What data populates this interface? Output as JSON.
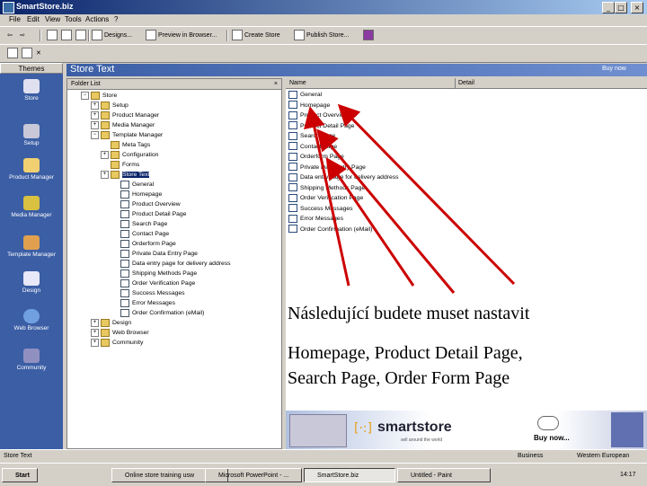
{
  "window": {
    "title": "SmartStore.biz"
  },
  "menu": [
    "File",
    "Edit",
    "View",
    "Tools",
    "Actions",
    "?"
  ],
  "toolbar": {
    "designs": "Designs...",
    "preview": "Preview in Browser...",
    "create_store": "Create Store",
    "publish_store": "Publish Store..."
  },
  "themes": {
    "header": "Themes",
    "items": [
      "Store",
      "Setup",
      "Product Manager",
      "Media Manager",
      "Template Manager",
      "Design",
      "Web Browser",
      "Community"
    ]
  },
  "main": {
    "title": "Store Text",
    "buy_now": "Buy now"
  },
  "folder_list": {
    "header": "Folder List",
    "items": [
      "Store",
      "Setup",
      "Product Manager",
      "Media Manager",
      "Template Manager",
      "Meta Tags",
      "Configuration",
      "Forms",
      "Store Text",
      "General",
      "Homepage",
      "Product Overview",
      "Product Detail Page",
      "Search Page",
      "Contact Page",
      "Orderform Page",
      "Private Data Entry Page",
      "Data entry page for delivery address",
      "Shipping Methods Page",
      "Order Verification Page",
      "Success Messages",
      "Error Messages",
      "Order Confirmation (eMail)",
      "Design",
      "Web Browser",
      "Community"
    ]
  },
  "item_list": {
    "col_name": "Name",
    "col_detail": "Detail",
    "items": [
      "General",
      "Homepage",
      "Product Overview",
      "Product Detail Page",
      "Search Page",
      "Contact Page",
      "Orderform Page",
      "Private Data Entry Page",
      "Data entry page for delivery address",
      "Shipping Methods Page",
      "Order Verification Page",
      "Success Messages",
      "Error Messages",
      "Order Confirmation (eMail)"
    ]
  },
  "overlay": {
    "line1": "Následující budete muset nastavit",
    "line2": "Homepage, Product Detail Page,",
    "line3": "Search Page, Order Form Page",
    "arrow_color": "#cc0000"
  },
  "banner": {
    "brand": "smartstore",
    "tagline": "sell around the world",
    "buy": "Buy now..."
  },
  "status": {
    "left": "Store Text",
    "right1": "Business",
    "right2": "Western European"
  },
  "taskbar": {
    "start": "Start",
    "tasks": [
      "Online store training usw",
      "Microsoft PowerPoint - ...",
      "SmartStore.biz",
      "Untitled - Paint"
    ],
    "clock": "14:17"
  }
}
